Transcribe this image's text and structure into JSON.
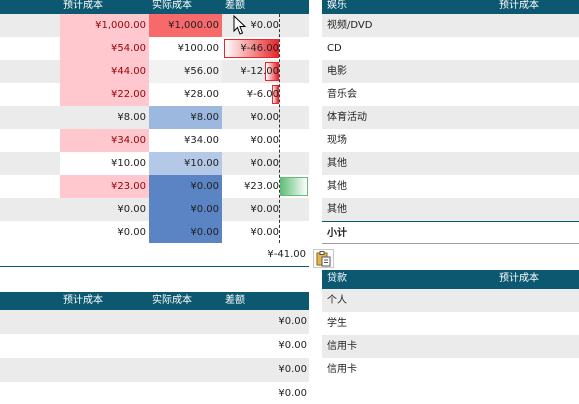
{
  "top_header": {
    "planned": "预计成本",
    "actual": "实际成本",
    "diff": "差额"
  },
  "right_top_header": {
    "category": "娱乐",
    "planned": "预计成本"
  },
  "top_rows": [
    {
      "planned": "¥1,000.00",
      "actual": "¥1,000.00",
      "diff": "¥0.00",
      "item": "视频/DVD",
      "planned_fill": "#ffc7ce",
      "actual_fill": "#f8696b",
      "planned_color": "#9c0006",
      "diff_bar": 0
    },
    {
      "planned": "¥54.00",
      "actual": "¥100.00",
      "diff": "¥-46.00",
      "item": "CD",
      "planned_fill": "#ffc7ce",
      "actual_fill": "#ffffff",
      "planned_color": "#9c0006",
      "diff_bar": 46
    },
    {
      "planned": "¥44.00",
      "actual": "¥56.00",
      "diff": "¥-12.00",
      "item": "电影",
      "planned_fill": "#ffc7ce",
      "actual_fill": "#f2f2f2",
      "planned_color": "#9c0006",
      "diff_bar": 12
    },
    {
      "planned": "¥22.00",
      "actual": "¥28.00",
      "diff": "¥-6.00",
      "item": "音乐会",
      "planned_fill": "#ffc7ce",
      "actual_fill": "#ffffff",
      "planned_color": "#9c0006",
      "diff_bar": 6
    },
    {
      "planned": "¥8.00",
      "actual": "¥8.00",
      "diff": "¥0.00",
      "item": "体育活动",
      "planned_fill": "#ebebeb",
      "actual_fill": "#9cb8df",
      "planned_color": "#222222",
      "diff_bar": 0
    },
    {
      "planned": "¥34.00",
      "actual": "¥34.00",
      "diff": "¥0.00",
      "item": "现场",
      "planned_fill": "#ffc7ce",
      "actual_fill": "#ffffff",
      "planned_color": "#9c0006",
      "diff_bar": 0
    },
    {
      "planned": "¥10.00",
      "actual": "¥10.00",
      "diff": "¥0.00",
      "item": "其他",
      "planned_fill": "#ffffff",
      "actual_fill": "#b4c9e8",
      "planned_color": "#222222",
      "diff_bar": 0
    },
    {
      "planned": "¥23.00",
      "actual": "¥0.00",
      "diff": "¥23.00",
      "item": "其他",
      "planned_fill": "#ffc7ce",
      "actual_fill": "#5b84c4",
      "planned_color": "#9c0006",
      "diff_bar": -23
    },
    {
      "planned": "¥0.00",
      "actual": "¥0.00",
      "diff": "¥0.00",
      "item": "其他",
      "planned_fill": "#ebebeb",
      "actual_fill": "#5b84c4",
      "planned_color": "#222222",
      "diff_bar": 0
    },
    {
      "planned": "¥0.00",
      "actual": "¥0.00",
      "diff": "¥0.00",
      "item": "小计",
      "planned_fill": "#ffffff",
      "actual_fill": "#5b84c4",
      "planned_color": "#222222",
      "diff_bar": 0
    }
  ],
  "total": {
    "value": "¥-41.00"
  },
  "bottom_header": {
    "planned": "预计成本",
    "actual": "实际成本",
    "diff": "差额"
  },
  "right_bottom_header": {
    "category": "贷款",
    "planned": "预计成本"
  },
  "bottom_rows": [
    {
      "diff": "¥0.00",
      "item": "个人"
    },
    {
      "diff": "¥0.00",
      "item": "学生"
    },
    {
      "diff": "¥0.00",
      "item": "信用卡"
    },
    {
      "diff": "¥0.00",
      "item": "信用卡"
    }
  ],
  "icons": {
    "cursor": "mouse-cursor-icon",
    "paste": "paste-options-icon"
  },
  "colors": {
    "header": "#0b5870",
    "stripe": "#ebebeb",
    "bar_negative": "#e8262b",
    "bar_positive": "#63be7b"
  }
}
